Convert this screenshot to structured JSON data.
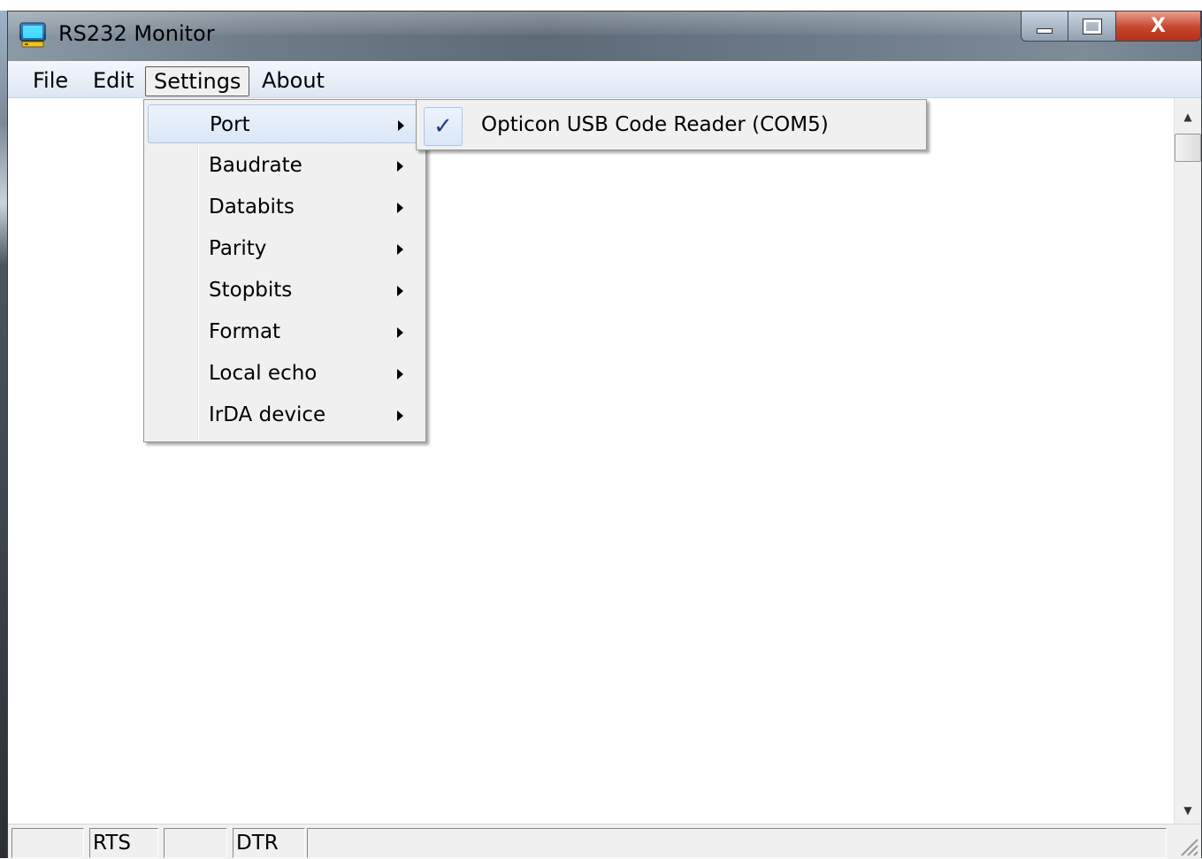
{
  "window": {
    "title": "RS232 Monitor",
    "controls": {
      "minimize": "minimize",
      "maximize": "maximize",
      "close": "X"
    }
  },
  "menubar": {
    "items": [
      {
        "label": "File"
      },
      {
        "label": "Edit"
      },
      {
        "label": "Settings",
        "active": true
      },
      {
        "label": "About"
      }
    ]
  },
  "settings_menu": {
    "items": [
      {
        "label": "Port",
        "highlighted": true,
        "has_submenu": true
      },
      {
        "label": "Baudrate",
        "has_submenu": true
      },
      {
        "label": "Databits",
        "has_submenu": true
      },
      {
        "label": "Parity",
        "has_submenu": true
      },
      {
        "label": "Stopbits",
        "has_submenu": true
      },
      {
        "label": "Format",
        "has_submenu": true
      },
      {
        "label": "Local echo",
        "has_submenu": true
      },
      {
        "label": "IrDA device",
        "has_submenu": true
      }
    ]
  },
  "port_submenu": {
    "items": [
      {
        "label": "Opticon USB Code Reader (COM5)",
        "checked": true,
        "check_glyph": "✓"
      }
    ]
  },
  "statusbar": {
    "panes": [
      "",
      "RTS",
      "",
      "DTR",
      ""
    ]
  },
  "icons": {
    "app": "monitor-icon",
    "submenu_arrow": "chevron-right-icon",
    "check": "checkmark-icon",
    "scroll_up": "scroll-up-arrow-icon",
    "scroll_down": "scroll-down-arrow-icon",
    "resize_grip": "resize-grip-icon"
  },
  "colors": {
    "menu_highlight_border": "#a8c6ea",
    "check_color": "#1b3c8a",
    "close_button": "#c6452d"
  }
}
